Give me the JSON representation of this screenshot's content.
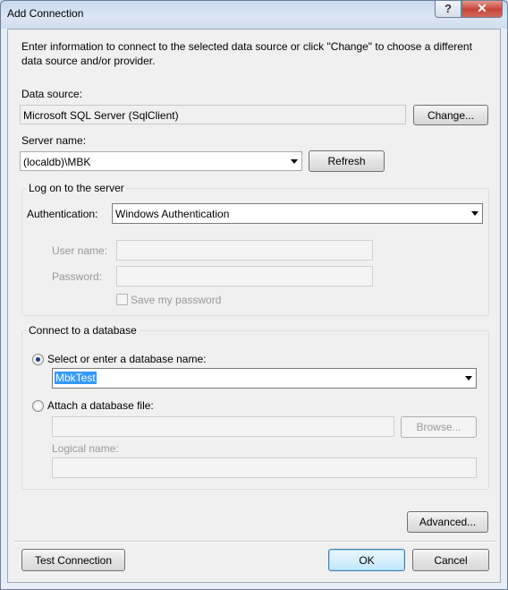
{
  "window": {
    "title": "Add Connection",
    "help_glyph": "?",
    "close_glyph": "✕"
  },
  "intro": "Enter information to connect to the selected data source or click \"Change\" to choose a different data source and/or provider.",
  "data_source": {
    "label": "Data source:",
    "value": "Microsoft SQL Server (SqlClient)",
    "change_button": "Change..."
  },
  "server": {
    "label": "Server name:",
    "value": "(localdb)\\MBK",
    "refresh_button": "Refresh"
  },
  "logon": {
    "group_label": "Log on to the server",
    "auth_label": "Authentication:",
    "auth_value": "Windows Authentication",
    "username_label": "User name:",
    "username_value": "",
    "password_label": "Password:",
    "password_value": "",
    "save_password_label": "Save my password",
    "save_password_checked": false
  },
  "database": {
    "group_label": "Connect to a database",
    "select_option_label": "Select or enter a database name:",
    "select_option_selected": true,
    "db_name_value": "MbkTest",
    "attach_option_label": "Attach a database file:",
    "attach_option_selected": false,
    "attach_file_value": "",
    "browse_button": "Browse...",
    "logical_name_label": "Logical name:",
    "logical_name_value": ""
  },
  "buttons": {
    "advanced": "Advanced...",
    "test_connection": "Test Connection",
    "ok": "OK",
    "cancel": "Cancel"
  }
}
